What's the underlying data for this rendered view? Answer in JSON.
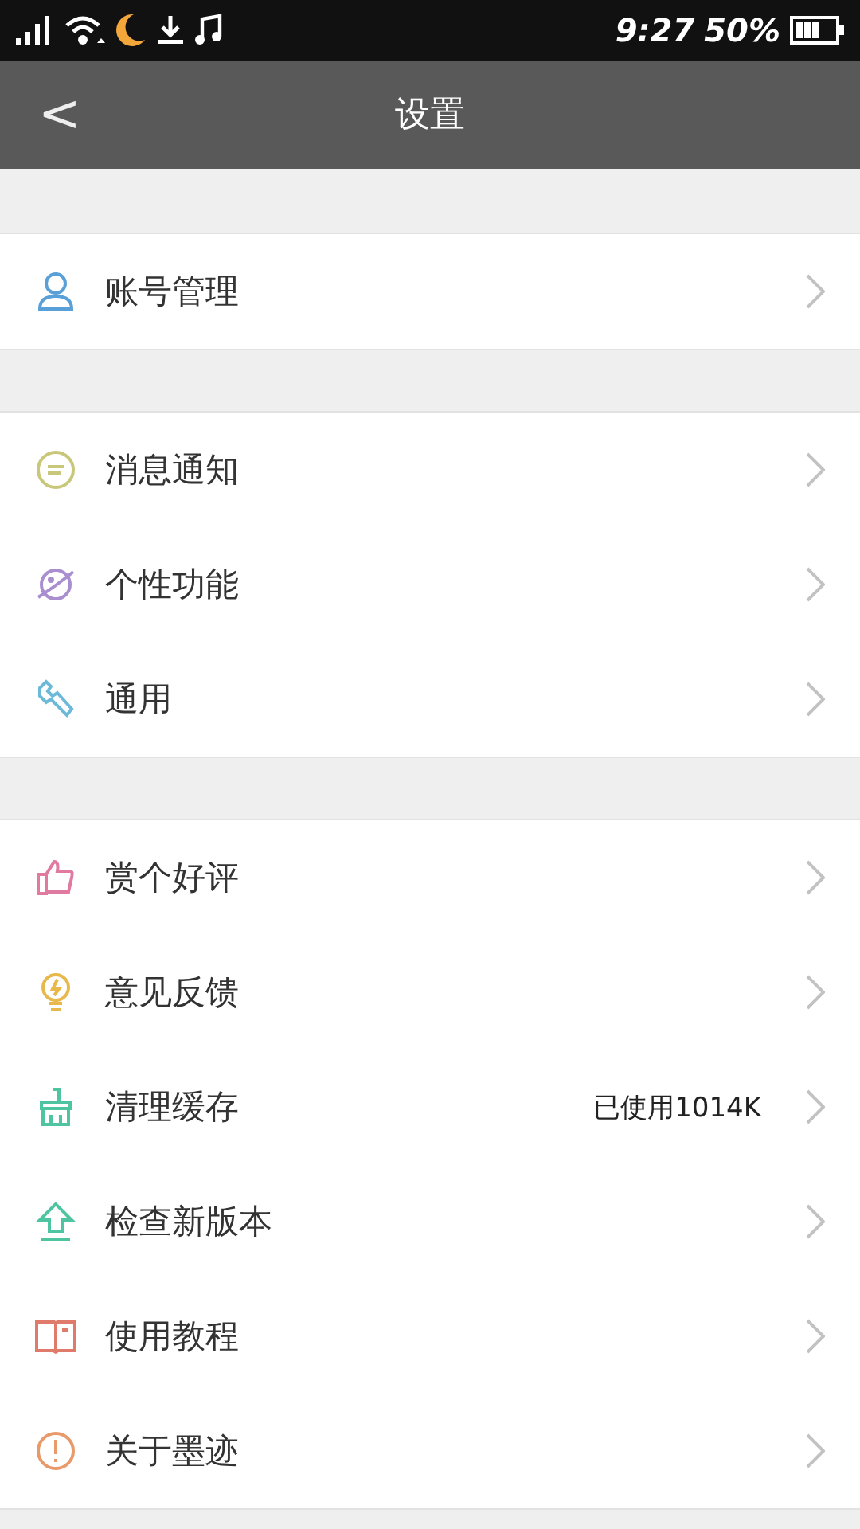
{
  "status_bar": {
    "time": "9:27",
    "battery_percent": "50%"
  },
  "header": {
    "back": "<",
    "title": "设置"
  },
  "sections": [
    {
      "items": [
        {
          "label": "账号管理"
        }
      ]
    },
    {
      "items": [
        {
          "label": "消息通知"
        },
        {
          "label": "个性功能"
        },
        {
          "label": "通用"
        }
      ]
    },
    {
      "items": [
        {
          "label": "赏个好评"
        },
        {
          "label": "意见反馈"
        },
        {
          "label": "清理缓存",
          "value": "已使用1014K"
        },
        {
          "label": "检查新版本"
        },
        {
          "label": "使用教程"
        },
        {
          "label": "关于墨迹"
        }
      ]
    }
  ]
}
